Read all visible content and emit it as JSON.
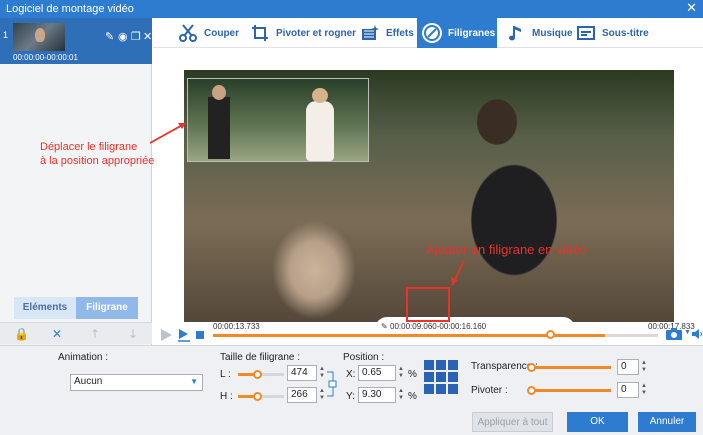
{
  "window": {
    "title": "Logiciel de montage vidéo",
    "close_glyph": "✕"
  },
  "clip": {
    "index": "1",
    "time": "00:00:00-00:00:01"
  },
  "toolbar": {
    "items": [
      {
        "label": "Couper",
        "icon": "scissors-icon"
      },
      {
        "label": "Pivoter et rogner",
        "icon": "crop-rotate-icon"
      },
      {
        "label": "Effets",
        "icon": "effects-icon"
      },
      {
        "label": "Filigranes",
        "icon": "watermark-icon",
        "active": true
      },
      {
        "label": "Musique",
        "icon": "music-icon"
      },
      {
        "label": "Sous-titre",
        "icon": "subtitle-icon"
      }
    ]
  },
  "left_tabs": {
    "elements": "Eléments",
    "watermark": "Filigrane"
  },
  "annotations": {
    "move_line1": "Déplacer le filigrane",
    "move_line2": "à la position appropriée",
    "add_video_watermark": "Ajouter un filigrane en vidéo"
  },
  "timeline": {
    "current": "00:00:13.733",
    "range": "00:00:09.060-00:00:16.160",
    "total": "00:00:17.833",
    "progress": 0.88
  },
  "settings": {
    "animation_label": "Animation :",
    "animation_value": "Aucun",
    "size_label": "Taille de filigrane :",
    "width_label": "L :",
    "width_value": "474",
    "height_label": "H :",
    "height_value": "266",
    "position_label": "Position :",
    "x_label": "X:",
    "x_value": "0.65",
    "y_label": "Y:",
    "y_value": "9.30",
    "percent": "%",
    "transparency_label": "Transparence :",
    "transparency_value": "0",
    "rotate_label": "Pivoter :",
    "rotate_value": "0"
  },
  "buttons": {
    "apply_all": "Appliquer à tout",
    "ok": "OK",
    "cancel": "Annuler"
  },
  "colors": {
    "accent": "#2e7cd0",
    "slider": "#f08a28",
    "annotation": "#e8332a"
  }
}
